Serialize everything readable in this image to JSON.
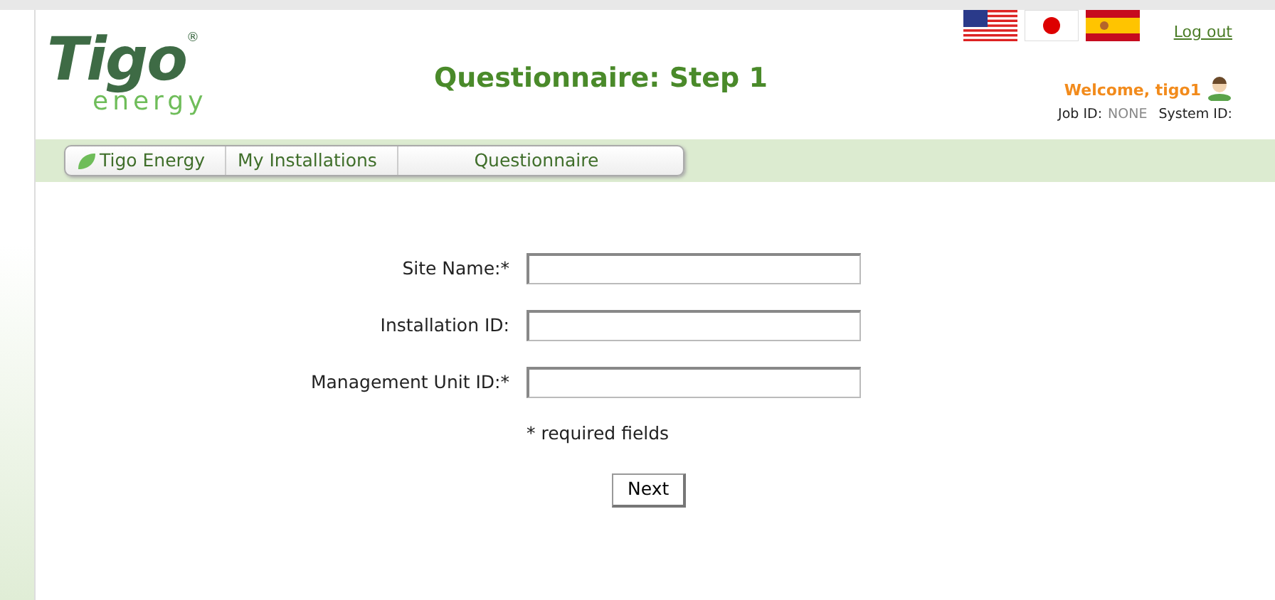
{
  "logo": {
    "name": "Tigo",
    "registered": "®",
    "tagline": "energy"
  },
  "page_title": "Questionnaire: Step 1",
  "languages": [
    {
      "kind": "us"
    },
    {
      "kind": "jp"
    },
    {
      "kind": "es"
    }
  ],
  "logout": "Log out",
  "welcome": "Welcome, tigo1",
  "job_id": {
    "label": "Job ID:",
    "value": "NONE"
  },
  "system_id": {
    "label": "System ID:"
  },
  "breadcrumb": [
    {
      "label": "Tigo Energy",
      "kind": "home"
    },
    {
      "label": "My Installations"
    },
    {
      "label": "Questionnaire"
    }
  ],
  "form": {
    "fields": [
      {
        "label": "Site Name:*"
      },
      {
        "label": "Installation ID:"
      },
      {
        "label": "Management Unit ID:*"
      }
    ],
    "note": "* required fields",
    "submit": "Next"
  }
}
